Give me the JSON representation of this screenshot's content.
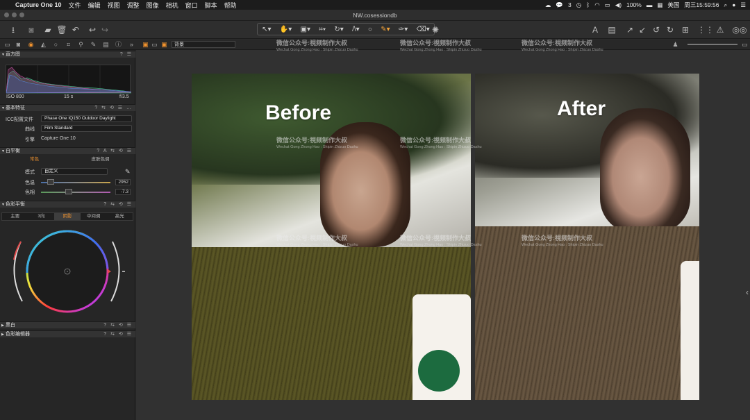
{
  "menubar": {
    "app_name": "Capture One 10",
    "items": [
      "文件",
      "编辑",
      "视图",
      "调整",
      "图像",
      "相机",
      "窗口",
      "脚本",
      "帮助"
    ],
    "status": {
      "wechat_count": "3",
      "battery": "100%",
      "input": "美国",
      "clock": "周三15:59:56"
    }
  },
  "window": {
    "title": "NW.cosessiondb"
  },
  "toolbar2": {
    "preset": "背景"
  },
  "watermark": {
    "main": "微信公众号:視频制作大叔",
    "sub": "Wechat Gong Zhong Hao : Shipin Zhizuo Dashu"
  },
  "panels": {
    "histogram": {
      "title": "直方图",
      "iso": "ISO 800",
      "shutter": "15 s",
      "aperture": "f/3.5"
    },
    "basic": {
      "title": "基本特征",
      "icc_label": "ICC配置文件",
      "icc_value": "Phase One IQ150 Outdoor Daylight",
      "curve_label": "曲线",
      "curve_value": "Film Standard",
      "engine_label": "引擎",
      "engine_value": "Capture One 10"
    },
    "white_balance": {
      "title": "白平衡",
      "tabs": [
        "常色",
        "皮肤色调"
      ],
      "mode_label": "模式",
      "mode_value": "自定义",
      "temp_label": "色温",
      "temp_value": "2952",
      "tint_label": "色相",
      "tint_value": "-7.3"
    },
    "color_balance": {
      "title": "色彩平衡",
      "tabs": [
        "主要",
        "3向",
        "阴影",
        "中间调",
        "高光"
      ],
      "active_tab": 2
    },
    "bw": {
      "title": "黑白"
    },
    "color_editor": {
      "title": "色彩编辑器"
    }
  },
  "viewer": {
    "before_label": "Before",
    "after_label": "After"
  },
  "colors": {
    "accent": "#f0922e",
    "panel": "#262626",
    "viewer_bg": "#313131"
  }
}
